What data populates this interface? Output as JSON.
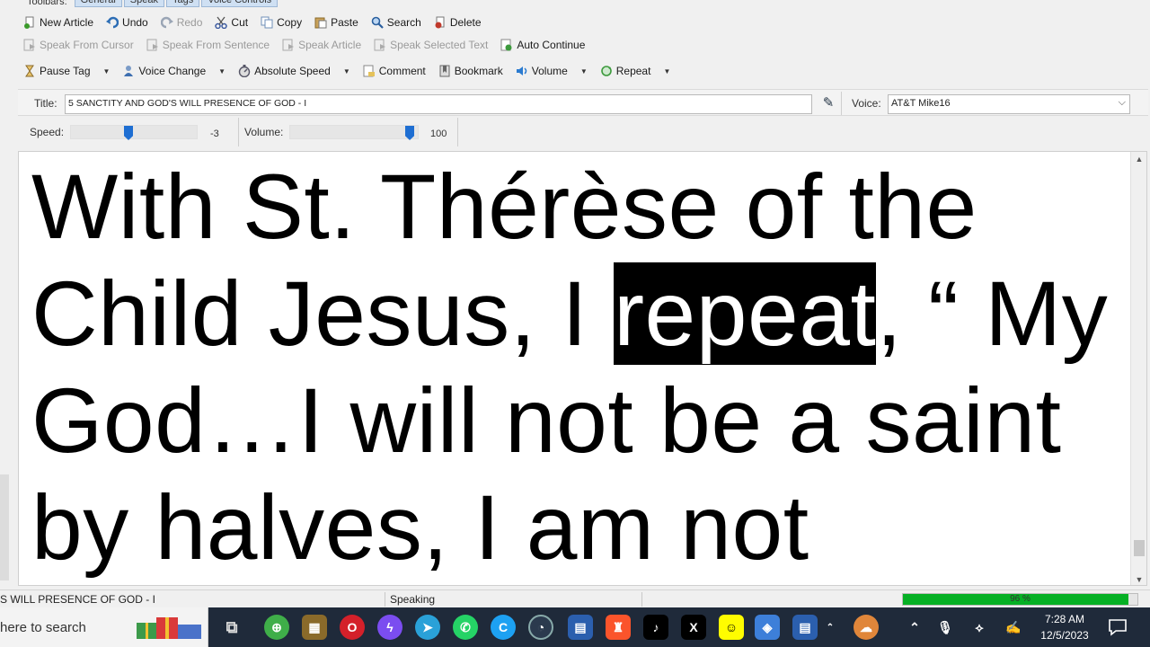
{
  "toolbars_tabs": {
    "label": "Toolbars:",
    "tabs": [
      "General",
      "Speak",
      "Tags",
      "Voice Controls"
    ]
  },
  "toolbar_general": [
    {
      "label": "New Article",
      "icon": "new-article-icon",
      "color": "#3a7b2a",
      "disabled": false
    },
    {
      "label": "Undo",
      "icon": "undo-icon",
      "color": "#2c6db5",
      "disabled": false
    },
    {
      "label": "Redo",
      "icon": "redo-icon",
      "color": "#9aa5b5",
      "disabled": true
    },
    {
      "label": "Cut",
      "icon": "cut-icon",
      "color": "#3b5aa0",
      "disabled": false
    },
    {
      "label": "Copy",
      "icon": "copy-icon",
      "color": "#6f8fb8",
      "disabled": false
    },
    {
      "label": "Paste",
      "icon": "paste-icon",
      "color": "#b58a3a",
      "disabled": false
    },
    {
      "label": "Search",
      "icon": "search-icon",
      "color": "#2a5f9e",
      "disabled": false
    },
    {
      "label": "Delete",
      "icon": "delete-icon",
      "color": "#c0392b",
      "disabled": false
    }
  ],
  "toolbar_speak": [
    {
      "label": "Speak From Cursor",
      "icon": "speak-from-cursor-icon",
      "disabled": true
    },
    {
      "label": "Speak From Sentence",
      "icon": "speak-from-sentence-icon",
      "disabled": true
    },
    {
      "label": "Speak Article",
      "icon": "speak-article-icon",
      "disabled": true
    },
    {
      "label": "Speak Selected Text",
      "icon": "speak-selected-text-icon",
      "disabled": true
    },
    {
      "label": "Auto Continue",
      "icon": "auto-continue-icon",
      "disabled": false
    }
  ],
  "toolbar_tags": [
    {
      "label": "Pause Tag",
      "icon": "hourglass-icon",
      "color": "#c9962f",
      "dropdown": true
    },
    {
      "label": "Voice Change",
      "icon": "voice-change-icon",
      "color": "#3d6fb0",
      "dropdown": true
    },
    {
      "label": "Absolute Speed",
      "icon": "speed-icon",
      "color": "#556",
      "dropdown": true
    },
    {
      "label": "Comment",
      "icon": "comment-icon",
      "color": "#c9a54a",
      "dropdown": false
    },
    {
      "label": "Bookmark",
      "icon": "bookmark-icon",
      "color": "#777",
      "dropdown": false
    },
    {
      "label": "Volume",
      "icon": "volume-icon",
      "color": "#2b7bd0",
      "dropdown": true
    },
    {
      "label": "Repeat",
      "icon": "repeat-icon",
      "color": "#3d9a3d",
      "dropdown": true
    }
  ],
  "title_row": {
    "title_label": "Title:",
    "title_value": "5 SANCTITY AND GOD'S WILL PRESENCE OF GOD - I",
    "voice_label": "Voice:",
    "voice_value": "AT&T Mike16"
  },
  "controls": {
    "speed_label": "Speed:",
    "speed_value": "-3",
    "speed_fraction": 0.45,
    "volume_label": "Volume:",
    "volume_value": "100",
    "volume_fraction": 1.0
  },
  "document": {
    "before": "With St. Thérèse of the Child Jesus, I ",
    "highlight": "repeat",
    "after": ", “ My God…I will not be a saint by halves, I am not"
  },
  "status": {
    "article": "S WILL PRESENCE OF GOD - I",
    "state": "Speaking",
    "progress_text": "96 %",
    "progress_fraction": 0.96
  },
  "taskbar": {
    "search_placeholder": "here to search",
    "time": "7:28 AM",
    "date": "12/5/2023"
  },
  "colors": {
    "highlight_bg": "#000000",
    "progress_green": "#06b025",
    "taskbar_bg": "#1f2a3a",
    "slider_thumb": "#1e6ed2"
  }
}
